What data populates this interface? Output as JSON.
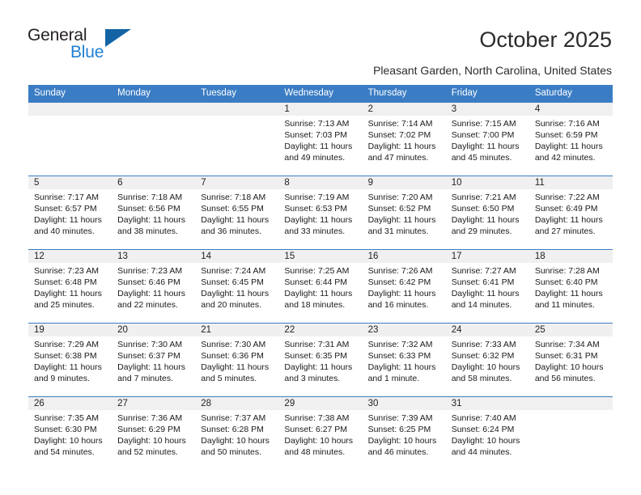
{
  "brand": {
    "name_part1": "General",
    "name_part2": "Blue",
    "logo_icon": "triangle-logo-icon",
    "accent_color": "#1464a5",
    "blue_text_color": "#1f7fd4"
  },
  "header": {
    "title": "October 2025",
    "subtitle": "Pleasant Garden, North Carolina, United States"
  },
  "calendar": {
    "header_color": "#3b7dc4",
    "daynum_strip_color": "#f0f0f0",
    "weekday_headers": [
      "Sunday",
      "Monday",
      "Tuesday",
      "Wednesday",
      "Thursday",
      "Friday",
      "Saturday"
    ],
    "weeks": [
      [
        {
          "day": "",
          "empty": true,
          "sunrise": "",
          "sunset": "",
          "daylight_line1": "",
          "daylight_line2": ""
        },
        {
          "day": "",
          "empty": true,
          "sunrise": "",
          "sunset": "",
          "daylight_line1": "",
          "daylight_line2": ""
        },
        {
          "day": "",
          "empty": true,
          "sunrise": "",
          "sunset": "",
          "daylight_line1": "",
          "daylight_line2": ""
        },
        {
          "day": "1",
          "empty": false,
          "sunrise": "Sunrise: 7:13 AM",
          "sunset": "Sunset: 7:03 PM",
          "daylight_line1": "Daylight: 11 hours",
          "daylight_line2": "and 49 minutes."
        },
        {
          "day": "2",
          "empty": false,
          "sunrise": "Sunrise: 7:14 AM",
          "sunset": "Sunset: 7:02 PM",
          "daylight_line1": "Daylight: 11 hours",
          "daylight_line2": "and 47 minutes."
        },
        {
          "day": "3",
          "empty": false,
          "sunrise": "Sunrise: 7:15 AM",
          "sunset": "Sunset: 7:00 PM",
          "daylight_line1": "Daylight: 11 hours",
          "daylight_line2": "and 45 minutes."
        },
        {
          "day": "4",
          "empty": false,
          "sunrise": "Sunrise: 7:16 AM",
          "sunset": "Sunset: 6:59 PM",
          "daylight_line1": "Daylight: 11 hours",
          "daylight_line2": "and 42 minutes."
        }
      ],
      [
        {
          "day": "5",
          "empty": false,
          "sunrise": "Sunrise: 7:17 AM",
          "sunset": "Sunset: 6:57 PM",
          "daylight_line1": "Daylight: 11 hours",
          "daylight_line2": "and 40 minutes."
        },
        {
          "day": "6",
          "empty": false,
          "sunrise": "Sunrise: 7:18 AM",
          "sunset": "Sunset: 6:56 PM",
          "daylight_line1": "Daylight: 11 hours",
          "daylight_line2": "and 38 minutes."
        },
        {
          "day": "7",
          "empty": false,
          "sunrise": "Sunrise: 7:18 AM",
          "sunset": "Sunset: 6:55 PM",
          "daylight_line1": "Daylight: 11 hours",
          "daylight_line2": "and 36 minutes."
        },
        {
          "day": "8",
          "empty": false,
          "sunrise": "Sunrise: 7:19 AM",
          "sunset": "Sunset: 6:53 PM",
          "daylight_line1": "Daylight: 11 hours",
          "daylight_line2": "and 33 minutes."
        },
        {
          "day": "9",
          "empty": false,
          "sunrise": "Sunrise: 7:20 AM",
          "sunset": "Sunset: 6:52 PM",
          "daylight_line1": "Daylight: 11 hours",
          "daylight_line2": "and 31 minutes."
        },
        {
          "day": "10",
          "empty": false,
          "sunrise": "Sunrise: 7:21 AM",
          "sunset": "Sunset: 6:50 PM",
          "daylight_line1": "Daylight: 11 hours",
          "daylight_line2": "and 29 minutes."
        },
        {
          "day": "11",
          "empty": false,
          "sunrise": "Sunrise: 7:22 AM",
          "sunset": "Sunset: 6:49 PM",
          "daylight_line1": "Daylight: 11 hours",
          "daylight_line2": "and 27 minutes."
        }
      ],
      [
        {
          "day": "12",
          "empty": false,
          "sunrise": "Sunrise: 7:23 AM",
          "sunset": "Sunset: 6:48 PM",
          "daylight_line1": "Daylight: 11 hours",
          "daylight_line2": "and 25 minutes."
        },
        {
          "day": "13",
          "empty": false,
          "sunrise": "Sunrise: 7:23 AM",
          "sunset": "Sunset: 6:46 PM",
          "daylight_line1": "Daylight: 11 hours",
          "daylight_line2": "and 22 minutes."
        },
        {
          "day": "14",
          "empty": false,
          "sunrise": "Sunrise: 7:24 AM",
          "sunset": "Sunset: 6:45 PM",
          "daylight_line1": "Daylight: 11 hours",
          "daylight_line2": "and 20 minutes."
        },
        {
          "day": "15",
          "empty": false,
          "sunrise": "Sunrise: 7:25 AM",
          "sunset": "Sunset: 6:44 PM",
          "daylight_line1": "Daylight: 11 hours",
          "daylight_line2": "and 18 minutes."
        },
        {
          "day": "16",
          "empty": false,
          "sunrise": "Sunrise: 7:26 AM",
          "sunset": "Sunset: 6:42 PM",
          "daylight_line1": "Daylight: 11 hours",
          "daylight_line2": "and 16 minutes."
        },
        {
          "day": "17",
          "empty": false,
          "sunrise": "Sunrise: 7:27 AM",
          "sunset": "Sunset: 6:41 PM",
          "daylight_line1": "Daylight: 11 hours",
          "daylight_line2": "and 14 minutes."
        },
        {
          "day": "18",
          "empty": false,
          "sunrise": "Sunrise: 7:28 AM",
          "sunset": "Sunset: 6:40 PM",
          "daylight_line1": "Daylight: 11 hours",
          "daylight_line2": "and 11 minutes."
        }
      ],
      [
        {
          "day": "19",
          "empty": false,
          "sunrise": "Sunrise: 7:29 AM",
          "sunset": "Sunset: 6:38 PM",
          "daylight_line1": "Daylight: 11 hours",
          "daylight_line2": "and 9 minutes."
        },
        {
          "day": "20",
          "empty": false,
          "sunrise": "Sunrise: 7:30 AM",
          "sunset": "Sunset: 6:37 PM",
          "daylight_line1": "Daylight: 11 hours",
          "daylight_line2": "and 7 minutes."
        },
        {
          "day": "21",
          "empty": false,
          "sunrise": "Sunrise: 7:30 AM",
          "sunset": "Sunset: 6:36 PM",
          "daylight_line1": "Daylight: 11 hours",
          "daylight_line2": "and 5 minutes."
        },
        {
          "day": "22",
          "empty": false,
          "sunrise": "Sunrise: 7:31 AM",
          "sunset": "Sunset: 6:35 PM",
          "daylight_line1": "Daylight: 11 hours",
          "daylight_line2": "and 3 minutes."
        },
        {
          "day": "23",
          "empty": false,
          "sunrise": "Sunrise: 7:32 AM",
          "sunset": "Sunset: 6:33 PM",
          "daylight_line1": "Daylight: 11 hours",
          "daylight_line2": "and 1 minute."
        },
        {
          "day": "24",
          "empty": false,
          "sunrise": "Sunrise: 7:33 AM",
          "sunset": "Sunset: 6:32 PM",
          "daylight_line1": "Daylight: 10 hours",
          "daylight_line2": "and 58 minutes."
        },
        {
          "day": "25",
          "empty": false,
          "sunrise": "Sunrise: 7:34 AM",
          "sunset": "Sunset: 6:31 PM",
          "daylight_line1": "Daylight: 10 hours",
          "daylight_line2": "and 56 minutes."
        }
      ],
      [
        {
          "day": "26",
          "empty": false,
          "sunrise": "Sunrise: 7:35 AM",
          "sunset": "Sunset: 6:30 PM",
          "daylight_line1": "Daylight: 10 hours",
          "daylight_line2": "and 54 minutes."
        },
        {
          "day": "27",
          "empty": false,
          "sunrise": "Sunrise: 7:36 AM",
          "sunset": "Sunset: 6:29 PM",
          "daylight_line1": "Daylight: 10 hours",
          "daylight_line2": "and 52 minutes."
        },
        {
          "day": "28",
          "empty": false,
          "sunrise": "Sunrise: 7:37 AM",
          "sunset": "Sunset: 6:28 PM",
          "daylight_line1": "Daylight: 10 hours",
          "daylight_line2": "and 50 minutes."
        },
        {
          "day": "29",
          "empty": false,
          "sunrise": "Sunrise: 7:38 AM",
          "sunset": "Sunset: 6:27 PM",
          "daylight_line1": "Daylight: 10 hours",
          "daylight_line2": "and 48 minutes."
        },
        {
          "day": "30",
          "empty": false,
          "sunrise": "Sunrise: 7:39 AM",
          "sunset": "Sunset: 6:25 PM",
          "daylight_line1": "Daylight: 10 hours",
          "daylight_line2": "and 46 minutes."
        },
        {
          "day": "31",
          "empty": false,
          "sunrise": "Sunrise: 7:40 AM",
          "sunset": "Sunset: 6:24 PM",
          "daylight_line1": "Daylight: 10 hours",
          "daylight_line2": "and 44 minutes."
        },
        {
          "day": "",
          "empty": true,
          "sunrise": "",
          "sunset": "",
          "daylight_line1": "",
          "daylight_line2": ""
        }
      ]
    ]
  }
}
